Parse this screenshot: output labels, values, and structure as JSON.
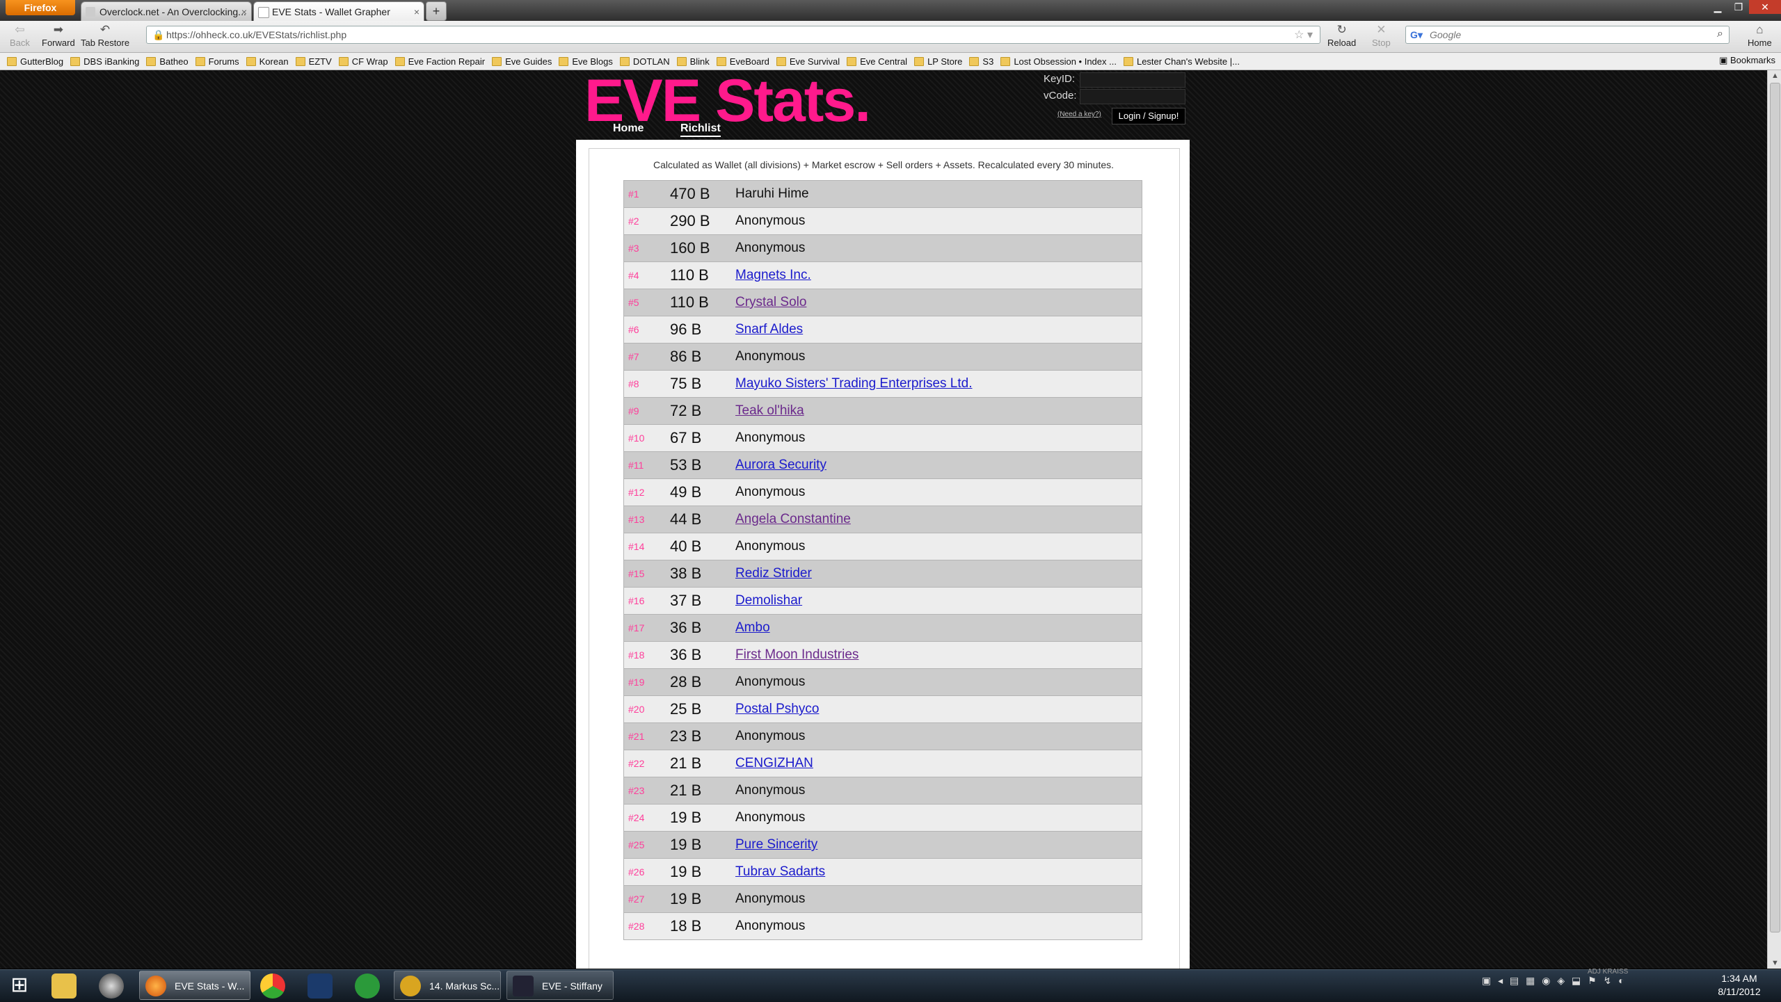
{
  "browser": {
    "app_button": "Firefox",
    "tabs": [
      {
        "title": "Overclock.net - An Overclocking...",
        "active": false
      },
      {
        "title": "EVE Stats - Wallet Grapher",
        "active": true
      }
    ],
    "new_tab": "+",
    "nav": {
      "back": "Back",
      "forward": "Forward",
      "tab_restore": "Tab Restore",
      "reload": "Reload",
      "stop": "Stop",
      "home": "Home"
    },
    "url": "https://ohheck.co.uk/EVEStats/richlist.php",
    "search_placeholder": "Google",
    "bookmarks": [
      "GutterBlog",
      "DBS iBanking",
      "Batheo",
      "Forums",
      "Korean",
      "EZTV",
      "CF Wrap",
      "Eve Faction Repair",
      "Eve Guides",
      "Eve Blogs",
      "DOTLAN",
      "Blink",
      "EveBoard",
      "Eve Survival",
      "Eve Central",
      "LP Store",
      "S3",
      "Lost Obsession • Index ...",
      "Lester Chan's Website |..."
    ],
    "bookmarks_menu": "Bookmarks"
  },
  "site": {
    "logo": "EVE Stats.",
    "nav": {
      "home": "Home",
      "richlist": "Richlist"
    },
    "login": {
      "keyid_label": "KeyID:",
      "vcode_label": "vCode:",
      "need_key": "(Need a key?)",
      "button": "Login / Signup!"
    },
    "caption": "Calculated as Wallet (all divisions) + Market escrow + Sell orders + Assets. Recalculated every 30 minutes.",
    "richlist": [
      {
        "rank": "#1",
        "amount": "470 B",
        "name": "Haruhi Hime",
        "link": false
      },
      {
        "rank": "#2",
        "amount": "290 B",
        "name": "Anonymous",
        "link": false
      },
      {
        "rank": "#3",
        "amount": "160 B",
        "name": "Anonymous",
        "link": false
      },
      {
        "rank": "#4",
        "amount": "110 B",
        "name": "Magnets Inc.",
        "link": true
      },
      {
        "rank": "#5",
        "amount": "110 B",
        "name": "Crystal Solo",
        "link": true,
        "visited": true
      },
      {
        "rank": "#6",
        "amount": "96 B",
        "name": "Snarf Aldes",
        "link": true
      },
      {
        "rank": "#7",
        "amount": "86 B",
        "name": "Anonymous",
        "link": false
      },
      {
        "rank": "#8",
        "amount": "75 B",
        "name": "Mayuko Sisters' Trading Enterprises Ltd.",
        "link": true
      },
      {
        "rank": "#9",
        "amount": "72 B",
        "name": "Teak ol'hika",
        "link": true,
        "visited": true
      },
      {
        "rank": "#10",
        "amount": "67 B",
        "name": "Anonymous",
        "link": false
      },
      {
        "rank": "#11",
        "amount": "53 B",
        "name": "Aurora Security",
        "link": true
      },
      {
        "rank": "#12",
        "amount": "49 B",
        "name": "Anonymous",
        "link": false
      },
      {
        "rank": "#13",
        "amount": "44 B",
        "name": "Angela Constantine",
        "link": true,
        "visited": true
      },
      {
        "rank": "#14",
        "amount": "40 B",
        "name": "Anonymous",
        "link": false
      },
      {
        "rank": "#15",
        "amount": "38 B",
        "name": "Rediz Strider",
        "link": true
      },
      {
        "rank": "#16",
        "amount": "37 B",
        "name": "Demolishar",
        "link": true
      },
      {
        "rank": "#17",
        "amount": "36 B",
        "name": "Ambo",
        "link": true
      },
      {
        "rank": "#18",
        "amount": "36 B",
        "name": "First Moon Industries",
        "link": true,
        "visited": true
      },
      {
        "rank": "#19",
        "amount": "28 B",
        "name": "Anonymous",
        "link": false
      },
      {
        "rank": "#20",
        "amount": "25 B",
        "name": "Postal Pshyco",
        "link": true
      },
      {
        "rank": "#21",
        "amount": "23 B",
        "name": "Anonymous",
        "link": false
      },
      {
        "rank": "#22",
        "amount": "21 B",
        "name": "CENGIZHAN",
        "link": true
      },
      {
        "rank": "#23",
        "amount": "21 B",
        "name": "Anonymous",
        "link": false
      },
      {
        "rank": "#24",
        "amount": "19 B",
        "name": "Anonymous",
        "link": false
      },
      {
        "rank": "#25",
        "amount": "19 B",
        "name": "Pure Sincerity",
        "link": true
      },
      {
        "rank": "#26",
        "amount": "19 B",
        "name": "Tubrav Sadarts",
        "link": true
      },
      {
        "rank": "#27",
        "amount": "19 B",
        "name": "Anonymous",
        "link": false
      },
      {
        "rank": "#28",
        "amount": "18 B",
        "name": "Anonymous",
        "link": false
      }
    ]
  },
  "taskbar": {
    "windows": [
      "EVE Stats - W...",
      "14. Markus Sc...",
      "EVE - Stiffany"
    ],
    "tray_user": "ADJ KRAISS",
    "time": "1:34 AM",
    "date": "8/11/2012"
  },
  "colors": {
    "brand_pink": "#ff1a8c",
    "rank_pink": "#ff3d9a",
    "link_blue": "#1a1acc",
    "link_visited": "#6b2a8c"
  }
}
